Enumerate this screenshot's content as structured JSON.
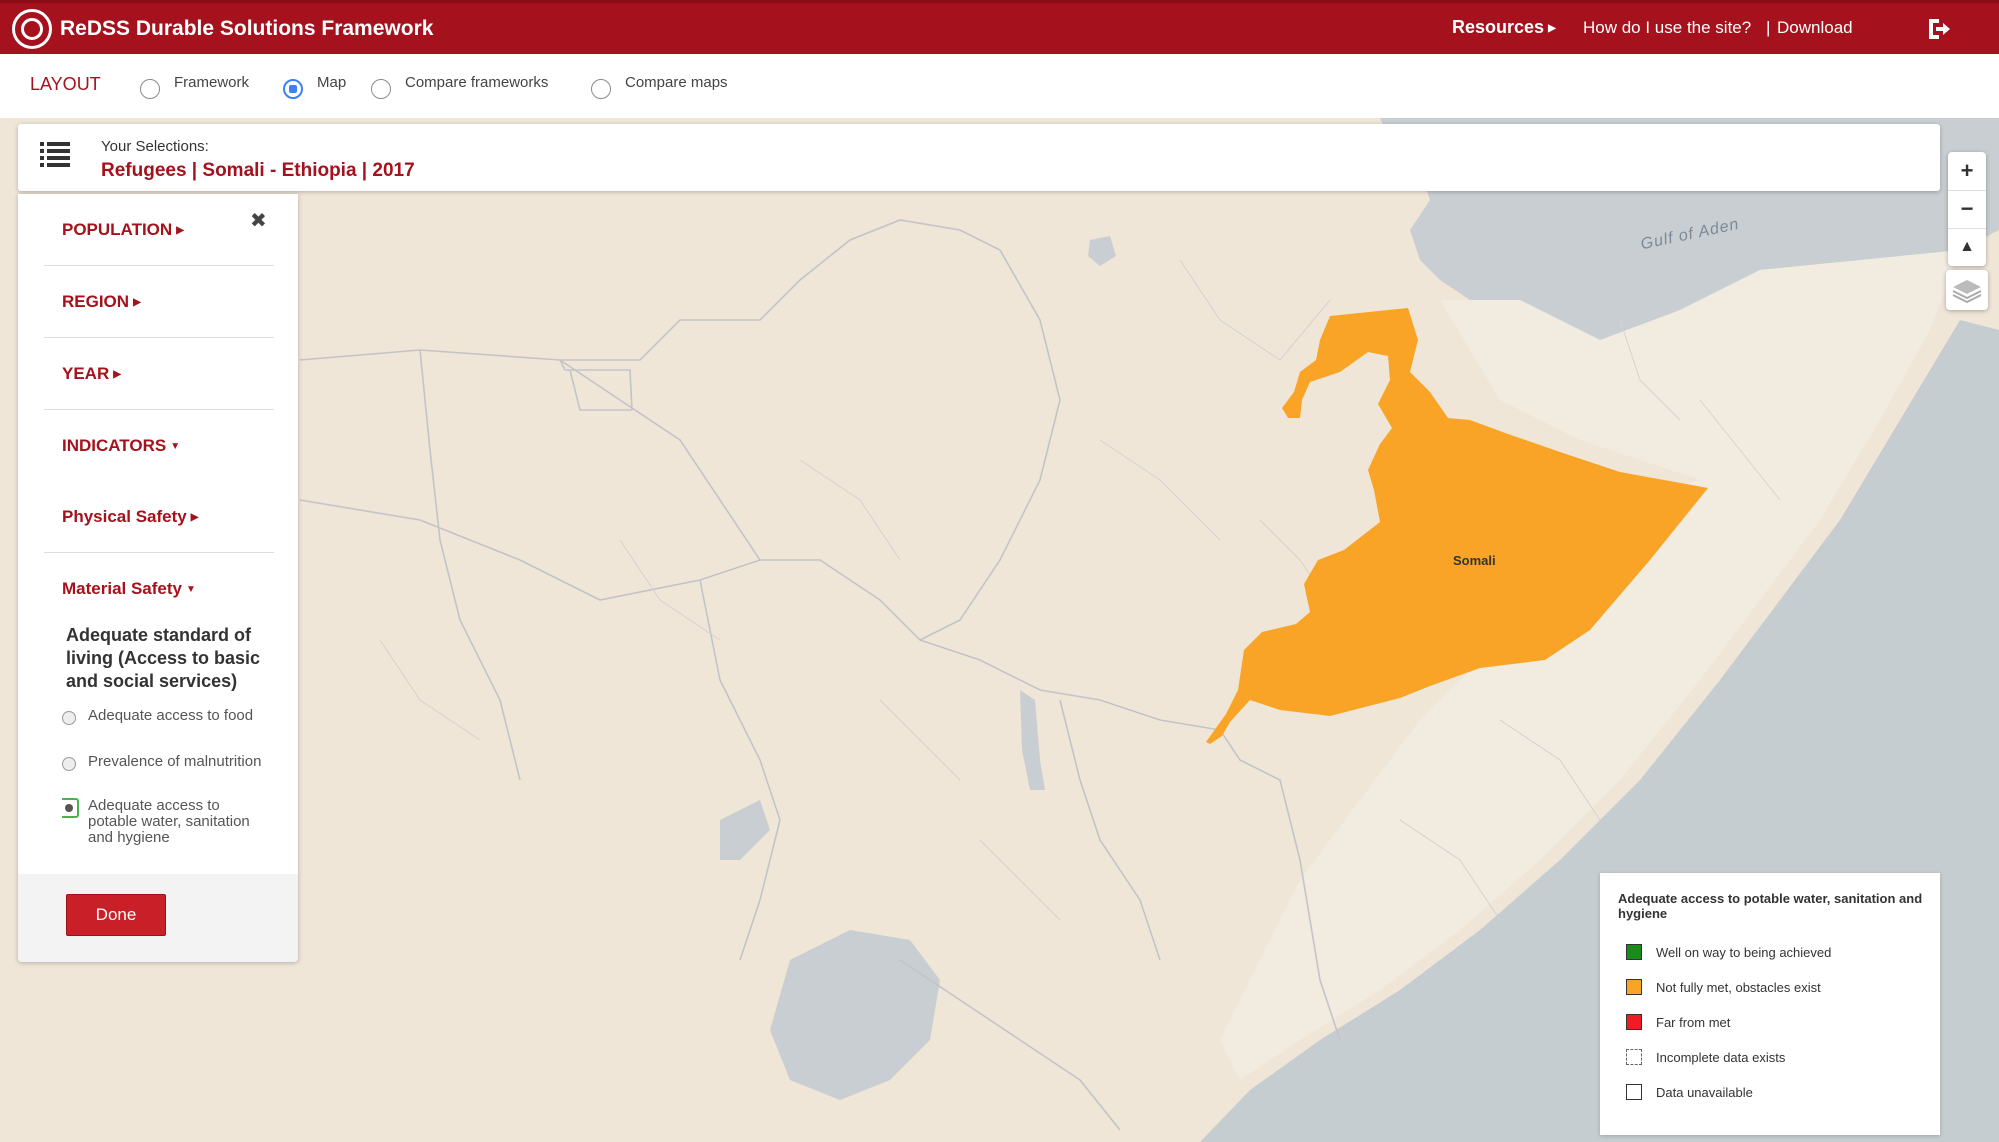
{
  "header": {
    "title": "ReDSS Durable Solutions Framework",
    "resources": "Resources",
    "help": "How do I use the site?",
    "separator": "|",
    "download": "Download"
  },
  "layout": {
    "label": "LAYOUT",
    "options": [
      "Framework",
      "Map",
      "Compare frameworks",
      "Compare maps"
    ],
    "selected": "Map"
  },
  "selections": {
    "label": "Your Selections:",
    "value": "Refugees | Somali - Ethiopia | 2017"
  },
  "panel": {
    "items": [
      "POPULATION",
      "REGION",
      "YEAR",
      "INDICATORS",
      "Physical Safety",
      "Material Safety"
    ],
    "indicator_title": "Adequate standard of living (Access to basic and social services)",
    "options": [
      {
        "label": "Adequate access to food",
        "checked": false
      },
      {
        "label": "Prevalence of malnutrition",
        "checked": false
      },
      {
        "label": "Adequate access to potable water, sanitation and hygiene",
        "checked": true
      }
    ],
    "done": "Done"
  },
  "map": {
    "water_label": "Gulf of Aden",
    "region_label": "Somali",
    "region_color": "#f9a427"
  },
  "legend": {
    "title": "Adequate access to potable water, sanitation and hygiene",
    "items": [
      {
        "label": "Well on way to being achieved",
        "color": "#1a8a1a"
      },
      {
        "label": "Not fully met, obstacles exist",
        "color": "#f9a427"
      },
      {
        "label": "Far from met",
        "color": "#ee1c24"
      },
      {
        "label": "Incomplete data exists",
        "color": "#ffffff"
      },
      {
        "label": "Data unavailable",
        "color": "#ffffff"
      }
    ]
  }
}
